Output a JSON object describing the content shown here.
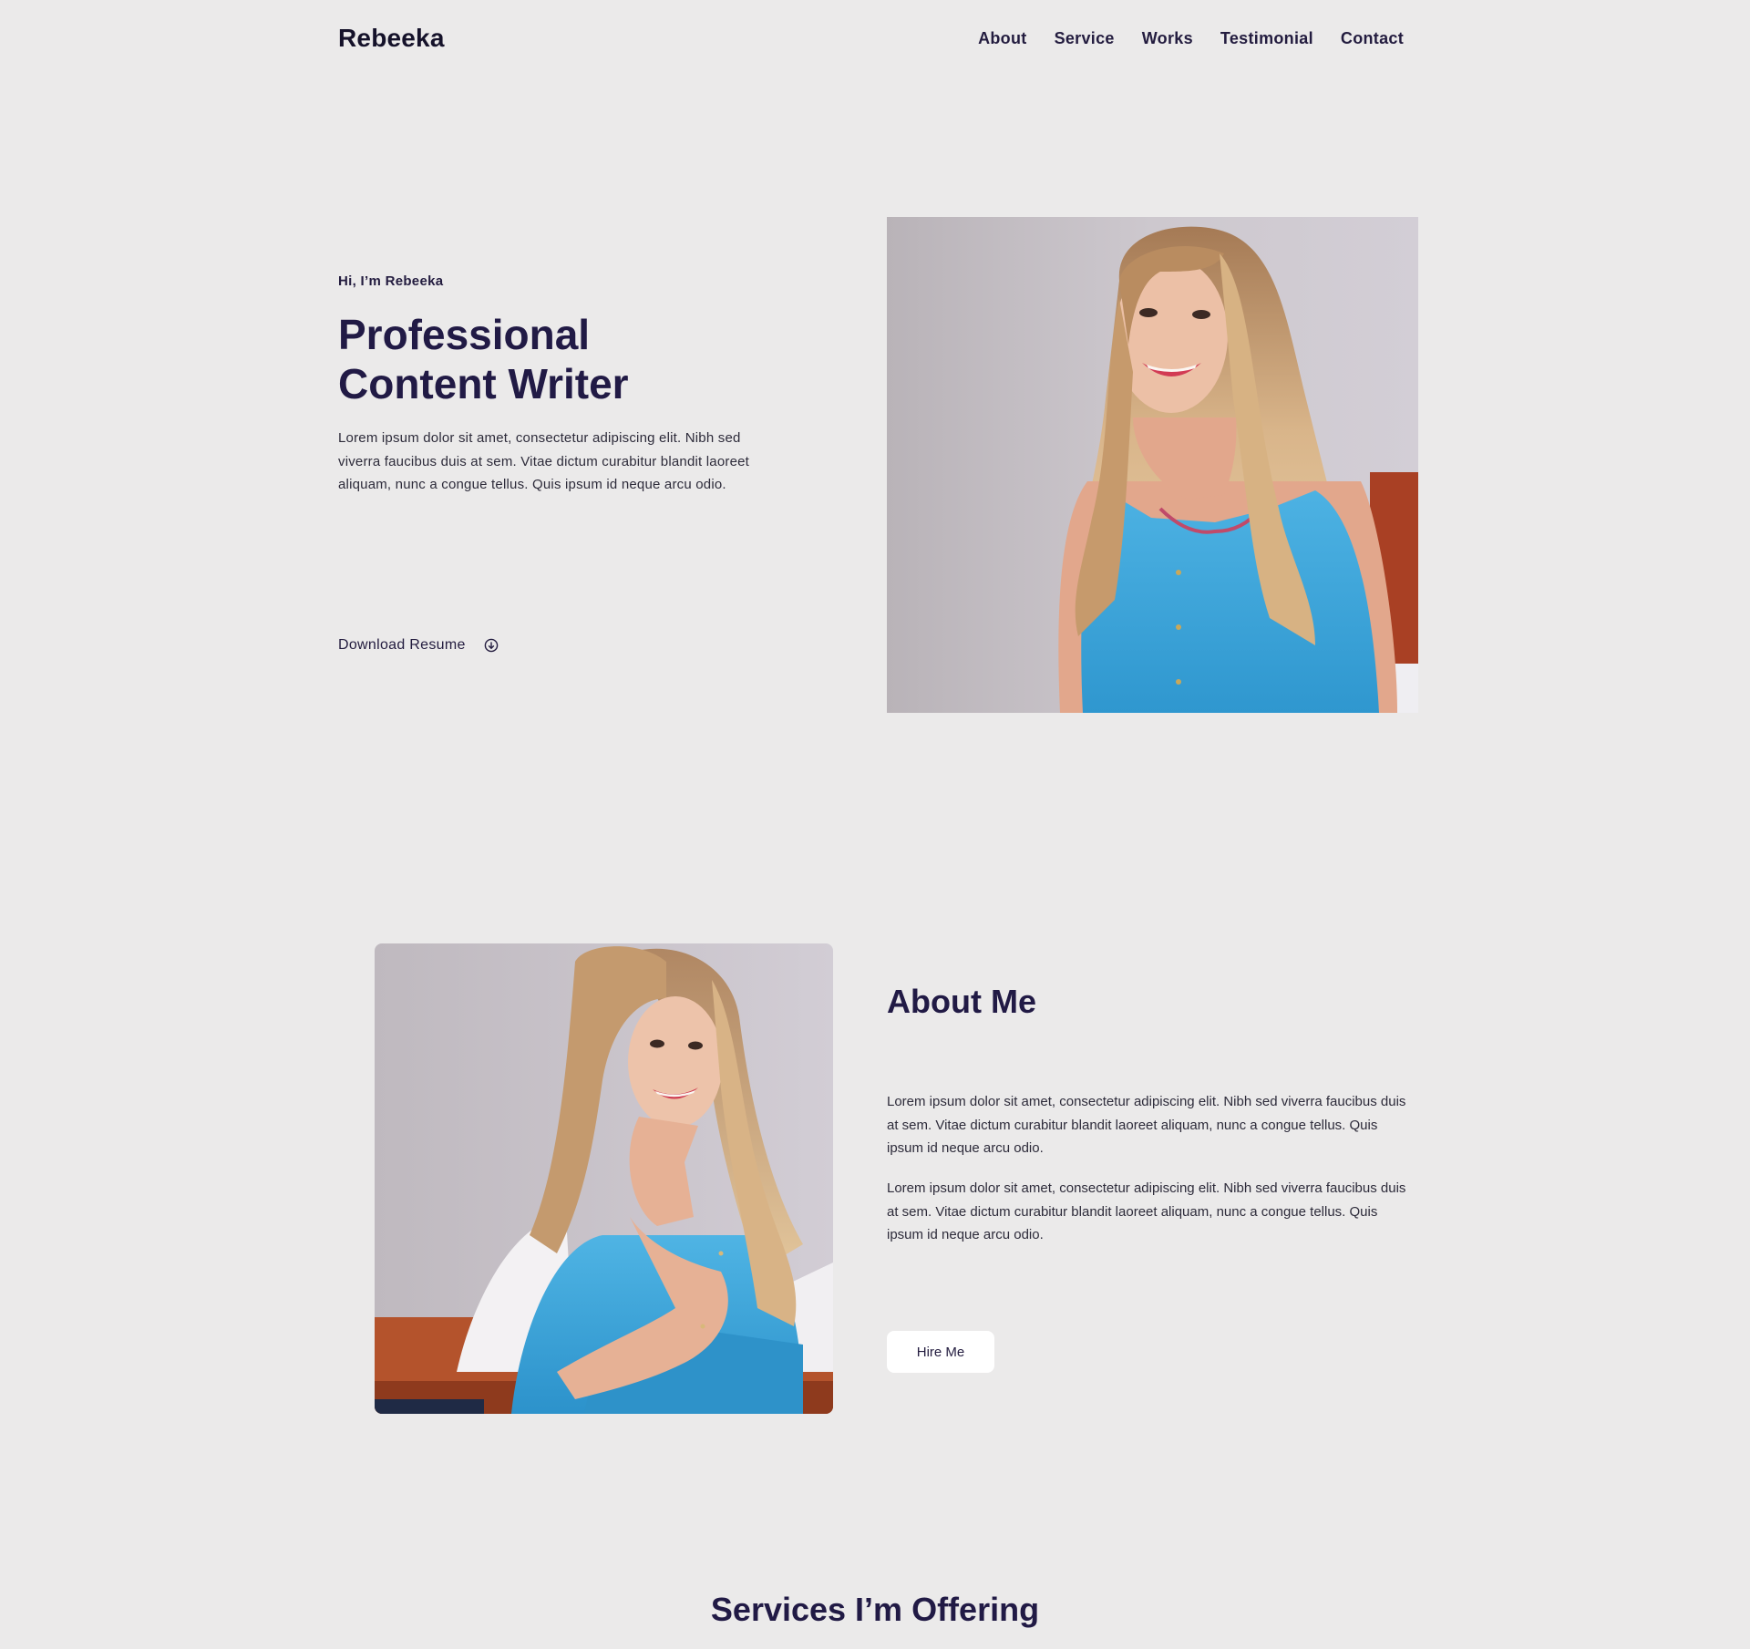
{
  "header": {
    "logo": "Rebeeka",
    "nav": [
      "About",
      "Service",
      "Works",
      "Testimonial",
      "Contact"
    ]
  },
  "hero": {
    "greeting": "Hi, I’m Rebeeka",
    "title_line1": "Professional",
    "title_line2": "Content Writer",
    "description": "Lorem ipsum dolor sit amet, consectetur adipiscing elit. Nibh sed viverra faucibus duis at sem. Vitae dictum curabitur blandit laoreet aliquam, nunc a congue tellus. Quis ipsum id neque arcu odio.",
    "download_label": "Download Resume",
    "download_icon": "arrow-down-circle-icon"
  },
  "about": {
    "title": "About Me",
    "paragraph1": "Lorem ipsum dolor sit amet, consectetur adipiscing elit. Nibh sed viverra faucibus duis at sem. Vitae dictum curabitur blandit laoreet aliquam, nunc a congue tellus. Quis ipsum id neque arcu odio.",
    "paragraph2": "Lorem ipsum dolor sit amet, consectetur adipiscing elit. Nibh sed viverra faucibus duis at sem. Vitae dictum curabitur blandit laoreet aliquam, nunc a congue tellus. Quis ipsum id neque arcu odio.",
    "hire_label": "Hire Me"
  },
  "services": {
    "title": "Services I’m Offering"
  },
  "colors": {
    "background": "#ebeaea",
    "heading": "#211a45",
    "text": "#2d2b3a",
    "button_bg": "#ffffff",
    "shirt": "#3aa6dc"
  }
}
